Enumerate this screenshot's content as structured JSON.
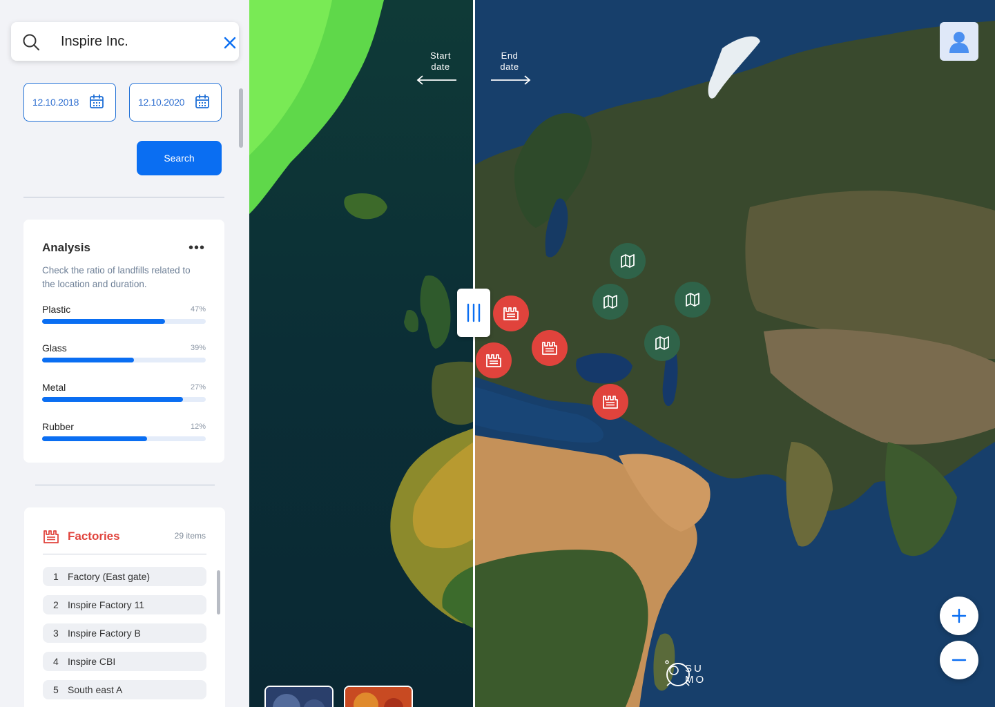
{
  "search": {
    "query": "Inspire Inc."
  },
  "dates": {
    "start": "12.10.2018",
    "end": "12.10.2020"
  },
  "search_button": {
    "label": "Search"
  },
  "analysis": {
    "title": "Analysis",
    "description": "Check the ratio of landfills related to the location and duration.",
    "stats": [
      {
        "label": "Plastic",
        "percent_label": "47%",
        "fill_fraction": 0.75
      },
      {
        "label": "Glass",
        "percent_label": "39%",
        "fill_fraction": 0.56
      },
      {
        "label": "Metal",
        "percent_label": "27%",
        "fill_fraction": 0.86
      },
      {
        "label": "Rubber",
        "percent_label": "12%",
        "fill_fraction": 0.64
      }
    ]
  },
  "factories": {
    "title": "Factories",
    "count": "29 items",
    "items": [
      {
        "num": "1",
        "name": "Factory (East gate)"
      },
      {
        "num": "2",
        "name": "Inspire Factory 11"
      },
      {
        "num": "3",
        "name": "Inspire Factory B"
      },
      {
        "num": "4",
        "name": "Inspire CBI"
      },
      {
        "num": "5",
        "name": "South east A"
      }
    ]
  },
  "map": {
    "start_caption": [
      "Start",
      "date"
    ],
    "end_caption": [
      "End",
      "date"
    ],
    "logo_text": [
      "SU",
      "MO"
    ]
  },
  "colors": {
    "accent": "#0a6ef2",
    "factory_marker": "#e0433c",
    "landfill_marker": "#2f6349"
  },
  "icons": {
    "search": "search-icon",
    "clear": "close-icon",
    "calendar": "calendar-icon",
    "factory": "factory-icon",
    "landfill": "map-icon",
    "user": "user-icon",
    "zoom_in": "plus-icon",
    "zoom_out": "minus-icon"
  }
}
